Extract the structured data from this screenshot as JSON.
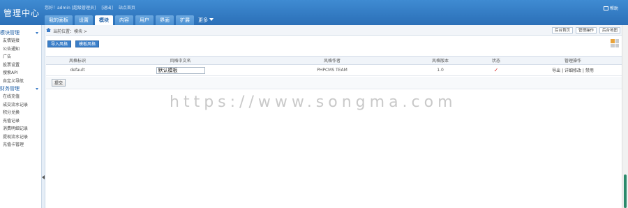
{
  "header": {
    "logo": "管理中心",
    "welcome": [
      "您好！admin [超级管理员]",
      "[退出]",
      "站点首页"
    ],
    "help_label": "帮助",
    "tabs": [
      {
        "label": "我的面板",
        "active": false
      },
      {
        "label": "设置",
        "active": false
      },
      {
        "label": "模块",
        "active": true
      },
      {
        "label": "内容",
        "active": false
      },
      {
        "label": "用户",
        "active": false
      },
      {
        "label": "界面",
        "active": false
      },
      {
        "label": "扩展",
        "active": false
      },
      {
        "label": "更多",
        "active": false
      }
    ]
  },
  "sidebar": {
    "sections": [
      {
        "title": "模块管理",
        "items": [
          "友情链接",
          "公告通知",
          "广告",
          "投票设置",
          "搜索API",
          "自定义导航"
        ]
      },
      {
        "title": "财务管理",
        "items": [
          "在线充值",
          "成交流水记录",
          "积分兑换",
          "充值记录",
          "消费明细记录",
          "提现流水记录",
          "充值卡管理"
        ]
      }
    ]
  },
  "breadcrumb": {
    "text": "当前位置：模块 >"
  },
  "crumb_actions": [
    "后台首页",
    "管理操作",
    "后台地图"
  ],
  "toolbar": {
    "buttons": [
      "导入风格",
      "模板风格"
    ]
  },
  "table": {
    "headers": [
      "风格标识",
      "风格中文名",
      "风格作者",
      "风格版本",
      "状态",
      "管理操作"
    ],
    "rows": [
      {
        "id": "default",
        "name": "默认模板",
        "author": "PHPCMS TEAM",
        "version": "1.0",
        "status": "✓",
        "ops": "导出 | 详细修改 | 禁用"
      }
    ]
  },
  "submit_label": "提交",
  "watermark": "https://www.songma.com"
}
